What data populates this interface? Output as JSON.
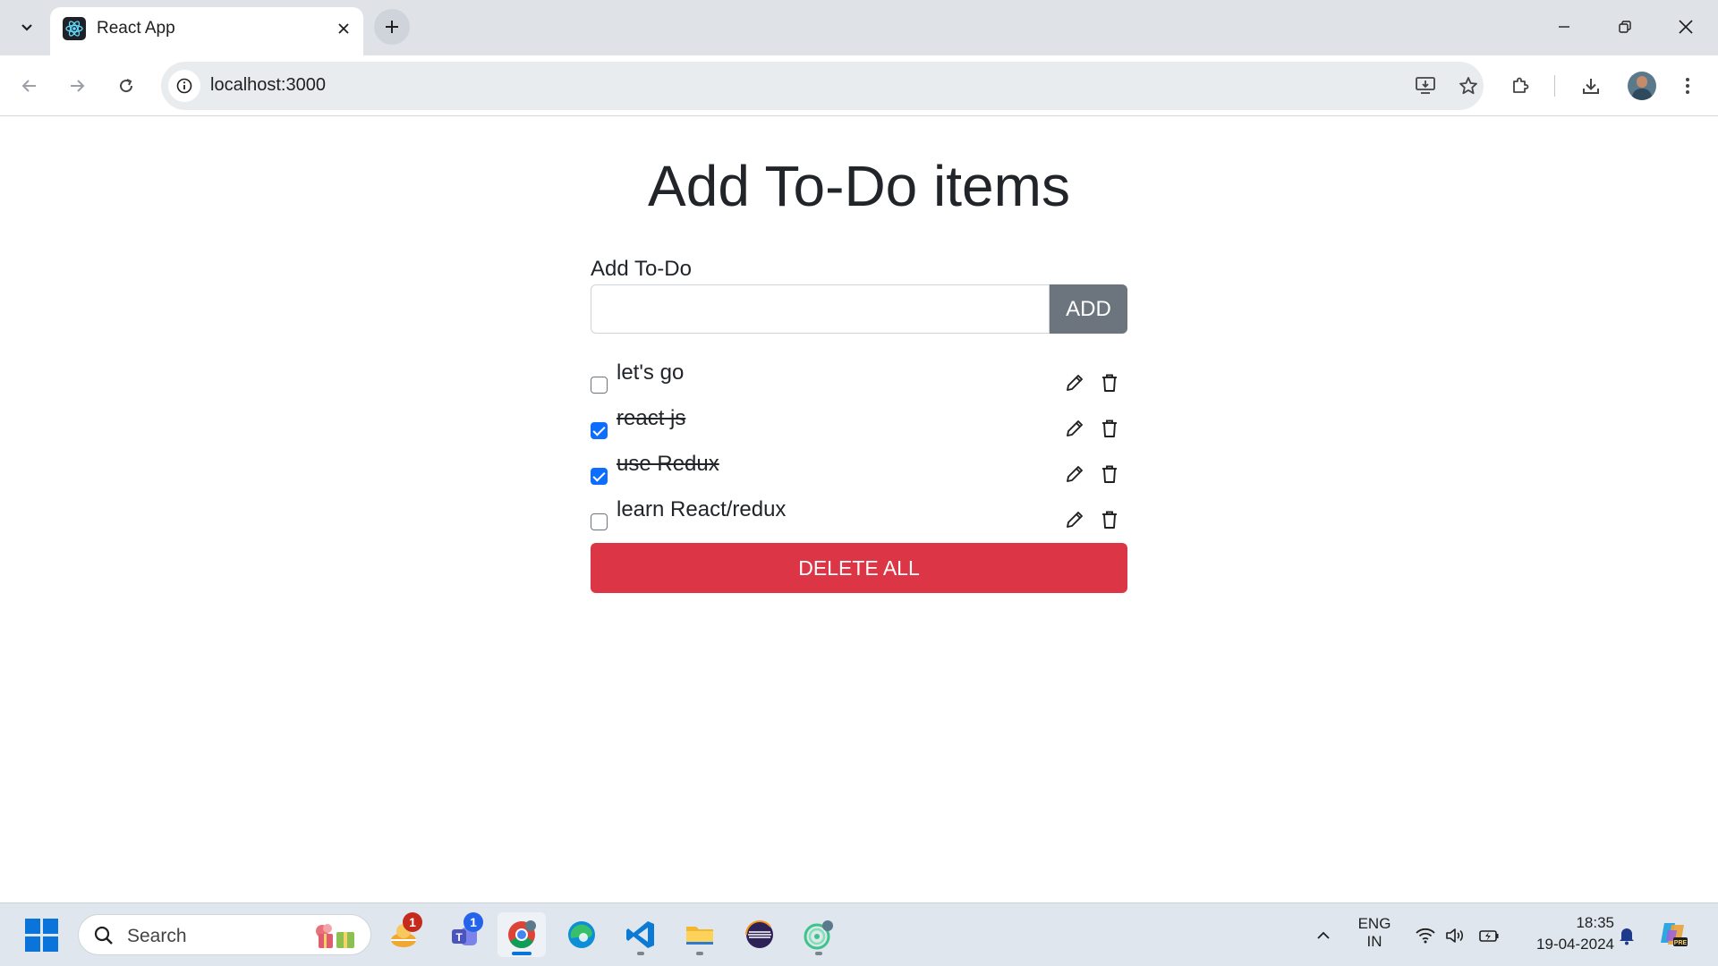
{
  "browser": {
    "tab_title": "React App",
    "url": "localhost:3000"
  },
  "page": {
    "heading": "Add To-Do items",
    "input_label": "Add To-Do",
    "input_value": "",
    "add_button": "ADD",
    "todos": [
      {
        "text": "let's go",
        "completed": false
      },
      {
        "text": "react js",
        "completed": true
      },
      {
        "text": "use Redux",
        "completed": true
      },
      {
        "text": "learn React/redux",
        "completed": false
      }
    ],
    "delete_all_button": "DELETE ALL"
  },
  "taskbar": {
    "search_label": "Search",
    "apps": [
      {
        "icon": "widgets-icon",
        "badge": "1",
        "badge_color": "#c42b1c"
      },
      {
        "icon": "teams-icon",
        "badge": "1",
        "badge_color": "#2563eb"
      },
      {
        "icon": "chrome-icon",
        "badge": ""
      },
      {
        "icon": "edge-icon",
        "badge": ""
      },
      {
        "icon": "vscode-icon",
        "badge": ""
      },
      {
        "icon": "file-explorer-icon",
        "badge": ""
      },
      {
        "icon": "eclipse-icon",
        "badge": ""
      },
      {
        "icon": "chrome-profile-icon",
        "badge": ""
      }
    ],
    "language_line1": "ENG",
    "language_line2": "IN",
    "time": "18:35",
    "date": "19-04-2024"
  },
  "colors": {
    "primary": "#0d6efd",
    "secondary": "#6c757d",
    "danger": "#dc3545"
  }
}
